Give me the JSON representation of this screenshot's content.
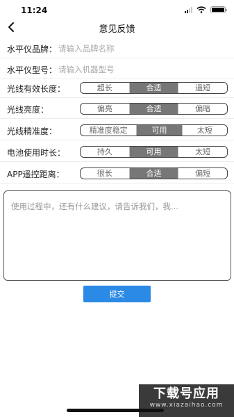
{
  "status_bar": {
    "time": "11:24"
  },
  "nav": {
    "title": "意见反馈"
  },
  "fields": [
    {
      "label": "水平仪品牌：",
      "placeholder": "请输入品牌名称",
      "value": ""
    },
    {
      "label": "水平仪型号：",
      "placeholder": "请输入机器型号",
      "value": ""
    }
  ],
  "ratings": [
    {
      "label": "光线有效长度：",
      "options": [
        "超长",
        "合适",
        "過短"
      ],
      "selected": 1
    },
    {
      "label": "光线亮度：",
      "options": [
        "偏亮",
        "合适",
        "偏暗"
      ],
      "selected": 1
    },
    {
      "label": "光线精准度：",
      "options": [
        "精准度稳定",
        "可用",
        "太短"
      ],
      "selected": 1
    },
    {
      "label": "电池使用时长：",
      "options": [
        "持久",
        "可用",
        "太短"
      ],
      "selected": 1
    },
    {
      "label": "APP遥控距离：",
      "options": [
        "很长",
        "合适",
        "偏短"
      ],
      "selected": 1
    }
  ],
  "feedback": {
    "placeholder": "使用过程中，还有什么建议，请告诉我们，我...",
    "value": ""
  },
  "submit": {
    "label": "提交"
  },
  "watermark": {
    "title": "下载号应用",
    "url": "www.xiazaihao.com"
  },
  "colors": {
    "accent": "#2b8ae6",
    "selected_segment": "#777777"
  },
  "icons": {
    "back": "back-arrow-icon",
    "signal": "signal-icon",
    "wifi": "wifi-icon",
    "battery": "battery-icon"
  }
}
